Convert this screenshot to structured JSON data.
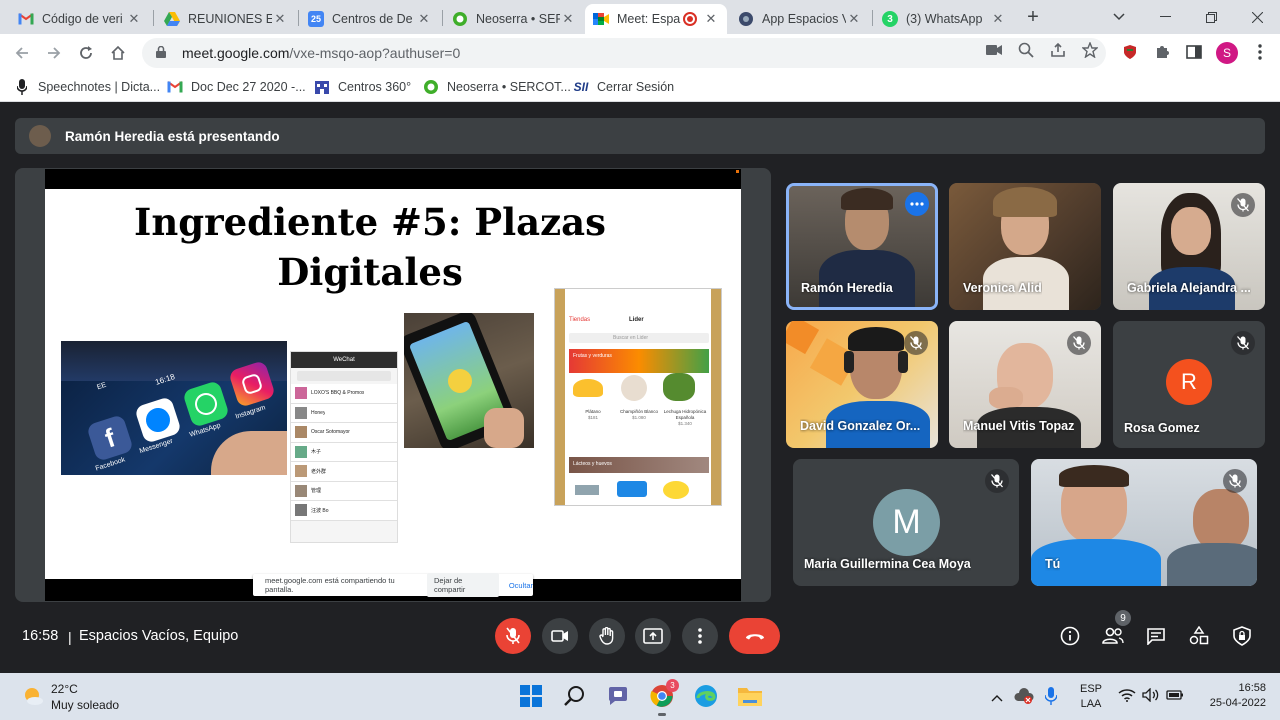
{
  "browser": {
    "tabs": [
      {
        "title": "Código de veri",
        "icon": "gmail-icon"
      },
      {
        "title": "REUNIONES EQ",
        "icon": "drive-icon"
      },
      {
        "title": "Centros de De",
        "icon": "calendar-icon"
      },
      {
        "title": "Neoserra • SER",
        "icon": "neoserra-icon"
      },
      {
        "title": "Meet: Espa",
        "icon": "meet-icon"
      },
      {
        "title": "App Espacios V",
        "icon": "app-icon"
      },
      {
        "title": "(3) WhatsApp",
        "icon": "whatsapp-icon"
      }
    ],
    "whatsapp_badge": "3",
    "url_host": "meet.google.com",
    "url_path": "/vxe-msqo-aop?authuser=0",
    "profile_initial": "S",
    "bookmarks": [
      {
        "label": "Speechnotes | Dicta...",
        "icon": "microphone-icon"
      },
      {
        "label": "Doc Dec 27 2020 -...",
        "icon": "gmail-icon"
      },
      {
        "label": "Centros 360°",
        "icon": "building-icon"
      },
      {
        "label": "Neoserra • SERCOT...",
        "icon": "neoserra-icon"
      },
      {
        "label": "Cerrar Sesión",
        "icon": "sii-icon"
      }
    ],
    "sii_logo": "SII"
  },
  "meet": {
    "presenting_text": "Ramón Heredia está presentando",
    "slide": {
      "title_line1": "Ingrediente #5: Plazas",
      "title_line2": "Digitales",
      "share_text": "meet.google.com está compartiendo tu pantalla.",
      "stop_label": "Dejar de compartir",
      "hide_label": "Ocultar",
      "wechat_title": "WeChat",
      "lider_title": "Lider",
      "lider_back": "Tiendas",
      "lider_search": "Buscar en Lider",
      "lider_section1": "Frutas y verduras",
      "lider_section2": "Lácteos y huevos",
      "products": [
        {
          "name": "Plátano",
          "price": "$181"
        },
        {
          "name": "Champiñón Blanco",
          "price": "$1.080"
        },
        {
          "name": "Lechuga Hidropónica Española",
          "price": "$1.340"
        }
      ],
      "app_labels": [
        "Facebook",
        "Messenger",
        "WhatsApp",
        "Instagram"
      ],
      "phone_time": "16:18",
      "phone_carrier": "EE",
      "wechat_chats": [
        "LOXO'S BBQ & Promos",
        "Honey",
        "Oscar Sotomayor",
        "木子",
        "老外群",
        "管理",
        "汪波 Bo"
      ]
    },
    "participants": [
      {
        "name": "Ramón Heredia",
        "muted": false,
        "speaking": true
      },
      {
        "name": "Veronica Alid",
        "muted": false
      },
      {
        "name": "Gabriela Alejandra ...",
        "muted": true
      },
      {
        "name": "David Gonzalez Or...",
        "muted": true
      },
      {
        "name": "Manuel Vitis Topaz",
        "muted": true
      },
      {
        "name": "Rosa Gomez",
        "muted": true,
        "initial": "R",
        "color": "#f4511e"
      },
      {
        "name": "Maria Guillermina Cea Moya",
        "muted": true,
        "initial": "M",
        "color": "#7b9ea6"
      },
      {
        "name": "Tú",
        "muted": true
      }
    ],
    "time": "16:58",
    "separator": "|",
    "meeting_name": "Espacios Vacíos, Equipo",
    "people_count": "9"
  },
  "taskbar": {
    "temperature": "22°C",
    "weather": "Muy soleado",
    "chrome_badge": "3",
    "lang_top": "ESP",
    "lang_bottom": "LAA",
    "clock_time": "16:58",
    "clock_date": "25-04-2022"
  },
  "colors": {
    "meet_bg": "#202124",
    "tile_bg": "#3c4043",
    "red": "#ea4335",
    "accent": "#1a73e8"
  }
}
